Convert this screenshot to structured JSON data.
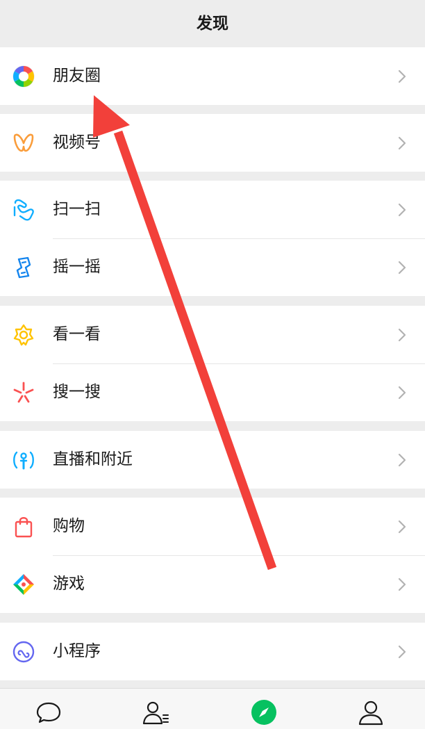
{
  "header": {
    "title": "发现"
  },
  "menu": [
    {
      "label": "朋友圈",
      "icon": "moments-icon"
    },
    {
      "label": "视频号",
      "icon": "channels-icon"
    },
    {
      "label": "扫一扫",
      "icon": "scan-icon"
    },
    {
      "label": "摇一摇",
      "icon": "shake-icon"
    },
    {
      "label": "看一看",
      "icon": "top-stories-icon"
    },
    {
      "label": "搜一搜",
      "icon": "search-icon"
    },
    {
      "label": "直播和附近",
      "icon": "live-nearby-icon"
    },
    {
      "label": "购物",
      "icon": "shopping-bag-icon"
    },
    {
      "label": "游戏",
      "icon": "games-icon"
    },
    {
      "label": "小程序",
      "icon": "mini-programs-icon"
    }
  ],
  "tabbar": {
    "tabs": [
      {
        "icon": "chats-icon",
        "active": false
      },
      {
        "icon": "contacts-icon",
        "active": false
      },
      {
        "icon": "discover-icon",
        "active": true
      },
      {
        "icon": "me-icon",
        "active": false
      }
    ]
  },
  "colors": {
    "background": "#ededed",
    "annotation_arrow": "#f2403a",
    "active_tab": "#07c160"
  }
}
